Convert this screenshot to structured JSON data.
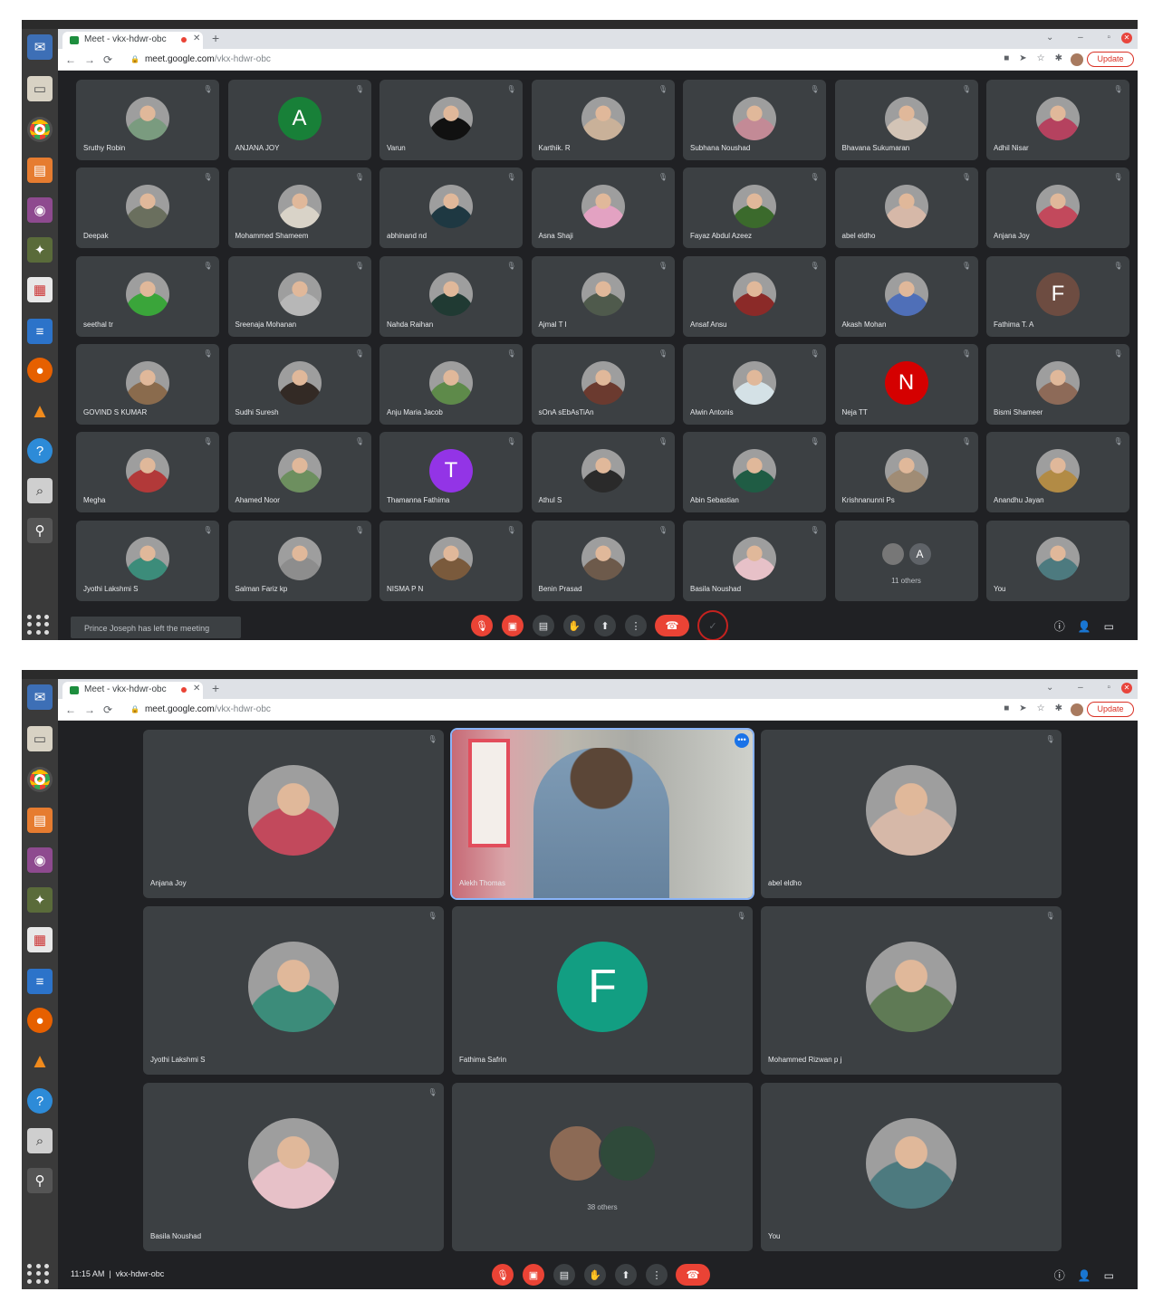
{
  "shared": {
    "tab_title": "Meet - vkx-hdwr-obc",
    "url_domain": "meet.google.com",
    "url_path": "/vkx-hdwr-obc",
    "update_label": "Update"
  },
  "shot1": {
    "participants": [
      {
        "name": "Sruthy Robin",
        "avatar": "photo",
        "color": "#7a9b7f"
      },
      {
        "name": "ANJANA JOY",
        "avatar": "A",
        "color": "#188038"
      },
      {
        "name": "Varun",
        "avatar": "photo",
        "color": "#111111"
      },
      {
        "name": "Karthik. R",
        "avatar": "photo",
        "color": "#c9b199"
      },
      {
        "name": "Subhana Noushad",
        "avatar": "photo",
        "color": "#c38a96"
      },
      {
        "name": "Bhavana Sukumaran",
        "avatar": "photo",
        "color": "#d3c4b6"
      },
      {
        "name": "Adhil Nisar",
        "avatar": "photo",
        "color": "#b5425f"
      },
      {
        "name": "Deepak",
        "avatar": "photo",
        "color": "#6a6f5e"
      },
      {
        "name": "Mohammed Shameem",
        "avatar": "photo",
        "color": "#d9d3c8"
      },
      {
        "name": "abhinand nd",
        "avatar": "photo",
        "color": "#1e3842"
      },
      {
        "name": "Asna Shaji",
        "avatar": "photo",
        "color": "#e3a2c2"
      },
      {
        "name": "Fayaz Abdul Azeez",
        "avatar": "photo",
        "color": "#3b6a2c"
      },
      {
        "name": "abel eldho",
        "avatar": "photo",
        "color": "#d6b8a8"
      },
      {
        "name": "Anjana Joy",
        "avatar": "photo",
        "color": "#c2495c"
      },
      {
        "name": "seethal tr",
        "avatar": "photo",
        "color": "#3aa53a"
      },
      {
        "name": "Sreenaja Mohanan",
        "avatar": "photo",
        "color": "#b7b7b7"
      },
      {
        "name": "Nahda Raihan",
        "avatar": "photo",
        "color": "#203a33"
      },
      {
        "name": "Ajmal T I",
        "avatar": "photo",
        "color": "#4f5a4c"
      },
      {
        "name": "Ansaf Ansu",
        "avatar": "photo",
        "color": "#8b2a28"
      },
      {
        "name": "Akash Mohan",
        "avatar": "photo",
        "color": "#4f6fb8"
      },
      {
        "name": "Fathima T. A",
        "avatar": "F",
        "color": "#6d4c41"
      },
      {
        "name": "GOVIND S KUMAR",
        "avatar": "photo",
        "color": "#8a6b4d"
      },
      {
        "name": "Sudhi Suresh",
        "avatar": "photo",
        "color": "#332a25"
      },
      {
        "name": "Anju Maria Jacob",
        "avatar": "photo",
        "color": "#5e8a4a"
      },
      {
        "name": "sOnA sEbAsTiAn",
        "avatar": "photo",
        "color": "#6b3a2f"
      },
      {
        "name": "Alwin Antonis",
        "avatar": "photo",
        "color": "#d4e1e6"
      },
      {
        "name": "Neja TT",
        "avatar": "N",
        "color": "#d50000"
      },
      {
        "name": "Bismi Shameer",
        "avatar": "photo",
        "color": "#8d6a58"
      },
      {
        "name": "Megha",
        "avatar": "photo",
        "color": "#b23939"
      },
      {
        "name": "Ahamed Noor",
        "avatar": "photo",
        "color": "#6d8f5f"
      },
      {
        "name": "Thamanna Fathima",
        "avatar": "T",
        "color": "#9334e6"
      },
      {
        "name": "Athul S",
        "avatar": "photo",
        "color": "#2a2a2a"
      },
      {
        "name": "Abin Sebastian",
        "avatar": "photo",
        "color": "#1f5c44"
      },
      {
        "name": "Krishnanunni Ps",
        "avatar": "photo",
        "color": "#a08c75"
      },
      {
        "name": "Anandhu Jayan",
        "avatar": "photo",
        "color": "#b28b45"
      },
      {
        "name": "Jyothi Lakshmi S",
        "avatar": "photo",
        "color": "#3c8c7a"
      },
      {
        "name": "Salman Fariz kp",
        "avatar": "photo",
        "color": "#8d8d8d"
      },
      {
        "name": "NISMA P N",
        "avatar": "photo",
        "color": "#7a5a3c"
      },
      {
        "name": "Benin Prasad",
        "avatar": "photo",
        "color": "#6d5a4b"
      },
      {
        "name": "Basila Noushad",
        "avatar": "photo",
        "color": "#e7c1c8"
      }
    ],
    "others_label": "11 others",
    "others_letter": "A",
    "self_label": "You",
    "toast": "Prince Joseph has left the meeting"
  },
  "shot2": {
    "tiles": [
      {
        "name": "Anjana Joy",
        "avatar": "photo",
        "color": "#c2495c"
      },
      {
        "name": "Alekh Thomas",
        "avatar": "video",
        "color": "#a9aaa5"
      },
      {
        "name": "abel eldho",
        "avatar": "photo",
        "color": "#d6b8a8"
      },
      {
        "name": "Jyothi Lakshmi S",
        "avatar": "photo",
        "color": "#3c8c7a"
      },
      {
        "name": "Fathima Safrin",
        "avatar": "F",
        "color": "#129e82"
      },
      {
        "name": "Mohammed Rizwan p j",
        "avatar": "photo",
        "color": "#5f7a55"
      },
      {
        "name": "Basila Noushad",
        "avatar": "photo",
        "color": "#e7c1c8"
      }
    ],
    "others_label": "38 others",
    "self_label": "You",
    "time": "11:15 AM",
    "meeting_code": "vkx-hdwr-obc"
  }
}
